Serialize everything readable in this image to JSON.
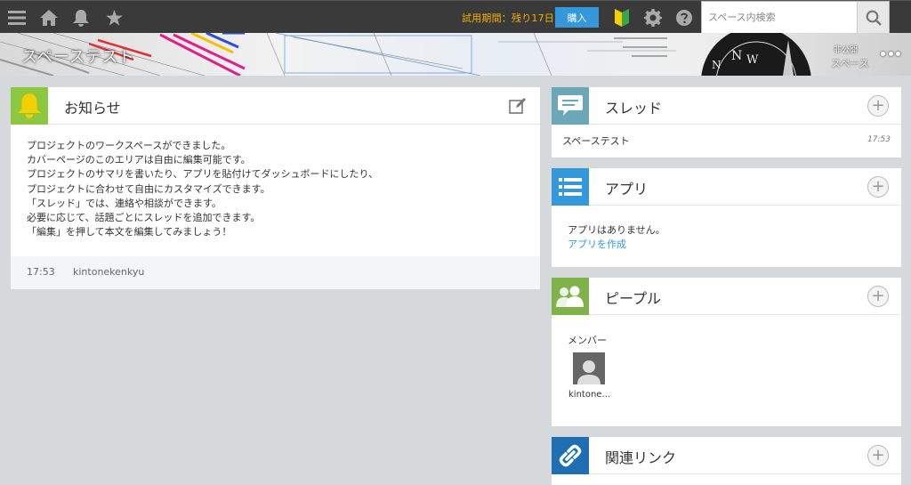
{
  "topbar": {
    "trial_text": "試用期間：残り17日",
    "buy_label": "購入",
    "search_placeholder": "スペース内検索"
  },
  "cover": {
    "space_title": "スペーステスト",
    "visibility_label": "非公開",
    "visibility_sub": "スペース"
  },
  "notice": {
    "title": "お知らせ",
    "lines": [
      "プロジェクトのワークスペースができました。",
      "カバーページのこのエリアは自由に編集可能です。",
      "プロジェクトのサマリを書いたり、アプリを貼付けてダッシュボードにしたり、",
      "プロジェクトに合わせて自由にカスタマイズできます。",
      "「スレッド」では、連絡や相談ができます。",
      "必要に応じて、話題ごとにスレッドを追加できます。",
      "「編集」を押して本文を編集してみましょう！"
    ],
    "footer_time": "17:53",
    "footer_user": "kintonekenkyu"
  },
  "thread": {
    "title": "スレッド",
    "items": [
      {
        "name": "スペーステスト",
        "time": "17:53"
      }
    ]
  },
  "apps": {
    "title": "アプリ",
    "empty_text": "アプリはありません。",
    "create_link": "アプリを作成"
  },
  "people": {
    "title": "ピープル",
    "members_label": "メンバー",
    "members": [
      {
        "name": "kintone…"
      }
    ]
  },
  "links": {
    "title": "関連リンク"
  },
  "colors": {
    "topbar": "#3a3a3a",
    "trial": "#f5b000",
    "accent": "#3498db",
    "notice_icon": "#8dc63f",
    "thread_icon": "#6ca7b8",
    "people_icon": "#7fb24a",
    "links_icon": "#1f6fb2"
  },
  "icons": [
    "menu-icon",
    "home-icon",
    "bell-icon",
    "star-icon",
    "beginner-mark-icon",
    "gear-icon",
    "help-icon",
    "search-icon",
    "edit-icon",
    "plus-icon",
    "chat-bubble-icon",
    "list-icon",
    "people-icon",
    "link-icon",
    "user-avatar-icon"
  ]
}
